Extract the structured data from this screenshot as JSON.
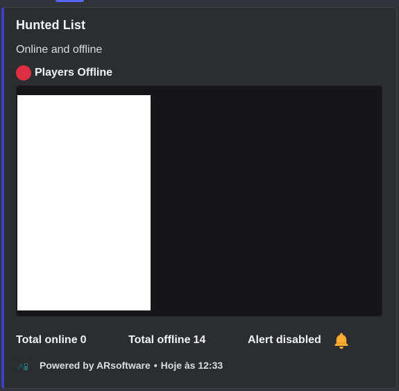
{
  "embed": {
    "accent_color": "#3b3fc4",
    "title": "Hunted List",
    "description": "Online and offline",
    "status": {
      "icon": "red-circle-icon",
      "color": "#dd2e44",
      "label": "Players Offline"
    },
    "fields": {
      "total_online_label": "Total online",
      "total_online_value": "0",
      "total_offline_label": "Total offline",
      "total_offline_value": "14",
      "alert_label": "Alert disabled",
      "alert_icon": "bell-icon"
    },
    "footer": {
      "icon": "arsoftware-logo-icon",
      "text": "Powered by ARsoftware",
      "separator": "•",
      "timestamp": "Hoje às 12:33"
    }
  }
}
